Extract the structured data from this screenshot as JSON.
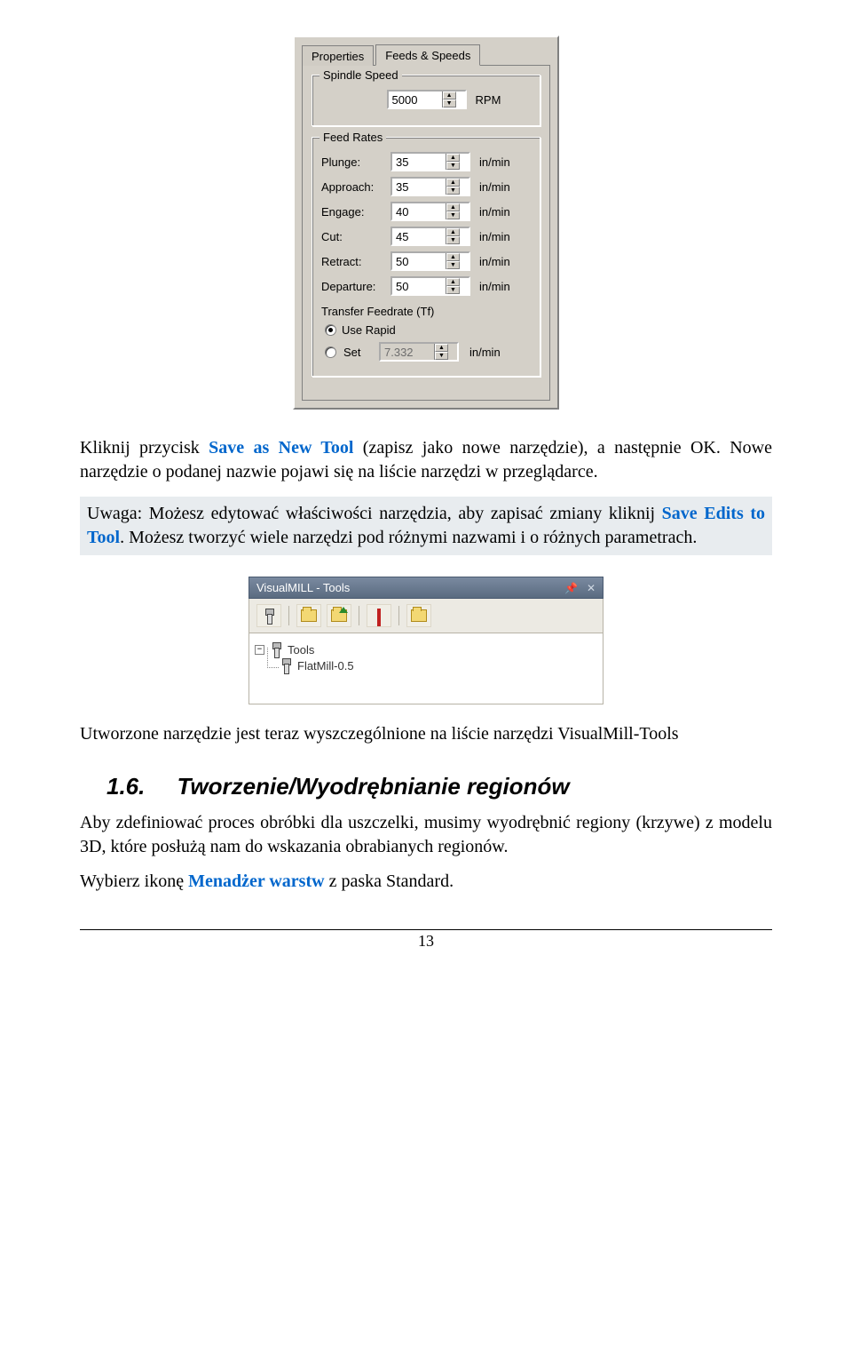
{
  "dialog1": {
    "tabs": {
      "properties": "Properties",
      "feeds": "Feeds & Speeds"
    },
    "spindle": {
      "title": "Spindle Speed",
      "value": "5000",
      "unit": "RPM"
    },
    "feedrates": {
      "title": "Feed Rates",
      "labels": {
        "plunge": "Plunge:",
        "approach": "Approach:",
        "engage": "Engage:",
        "cut": "Cut:",
        "retract": "Retract:",
        "departure": "Departure:",
        "transfer": "Transfer Feedrate (Tf)"
      },
      "values": {
        "plunge": "35",
        "approach": "35",
        "engage": "40",
        "cut": "45",
        "retract": "50",
        "departure": "50"
      },
      "unit": "in/min",
      "radio": {
        "use_rapid": "Use Rapid",
        "set": "Set",
        "set_value": "7.332"
      }
    }
  },
  "doc": {
    "p1_a": "Kliknij przycisk ",
    "p1_b": "Save as New Tool",
    "p1_c": " (zapisz jako nowe narzędzie), a następnie OK. Nowe narzędzie o podanej nazwie pojawi się na liście narzędzi w przeglądarce.",
    "notice_a": "Uwaga: Możesz edytować właściwości narzędzia, aby zapisać zmiany kliknij ",
    "notice_b": "Save Edits to Tool",
    "notice_c": ". Możesz tworzyć wiele narzędzi pod różnymi nazwami i o różnych parametrach.",
    "p2": "Utworzone narzędzie jest teraz wyszczególnione na liście narzędzi VisualMill-Tools",
    "heading_num": "1.6.",
    "heading_text": "Tworzenie/Wyodrębnianie regionów",
    "p3": "Aby zdefiniować proces obróbki dla uszczelki, musimy wyodrębnić regiony (krzywe) z modelu 3D, które posłużą nam do wskazania obrabianych regionów.",
    "p4_a": "Wybierz ikonę ",
    "p4_b": "Menadżer warstw",
    "p4_c": " z paska Standard.",
    "page_num": "13"
  },
  "panel2": {
    "title": "VisualMILL - Tools",
    "pin": "📌",
    "close": "✕",
    "tree": {
      "root": "Tools",
      "child": "FlatMill-0.5",
      "toggle": "−"
    }
  }
}
